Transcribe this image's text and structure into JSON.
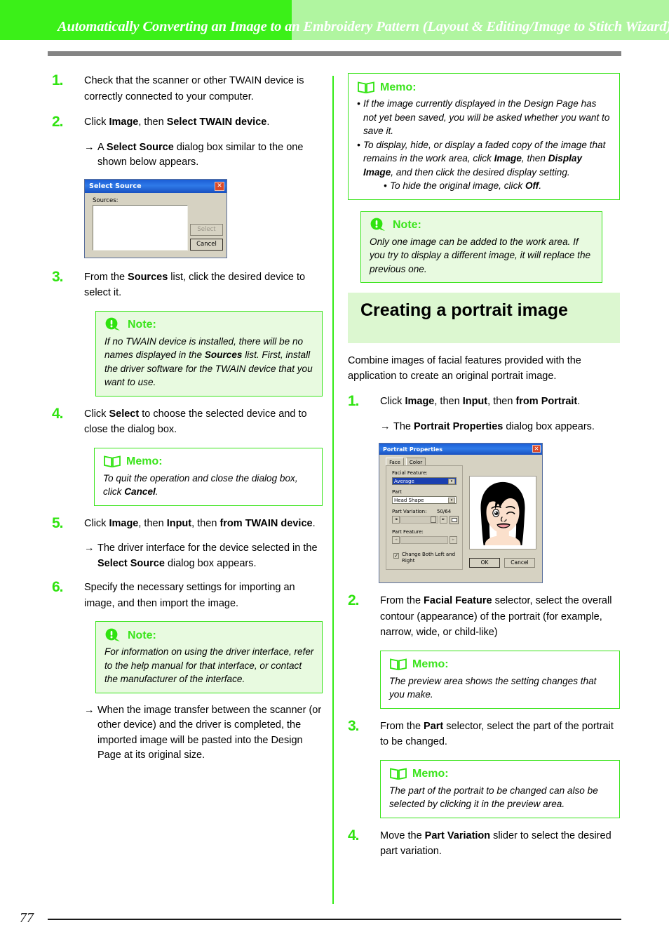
{
  "header": {
    "title": "Automatically Converting an Image to an Embroidery Pattern (Layout & Editing/Image to Stitch Wizard)",
    "band_color_dark": "#3bf018",
    "band_color_light": "#b0f5a0",
    "rule_color": "#848484"
  },
  "footer": {
    "page_number": "77"
  },
  "accent": {
    "green": "#2fe30f",
    "note_bg": "#e8fae0",
    "section_bg": "#dcf7d0",
    "divider": "#34ec16"
  },
  "left_column": {
    "steps": [
      {
        "number": "1.",
        "text_parts": [
          {
            "t": "Check that the scanner or other TWAIN device is correctly connected to your computer.",
            "b": false
          }
        ]
      },
      {
        "number": "2.",
        "text_parts": [
          {
            "t": "Click ",
            "b": false
          },
          {
            "t": "Image",
            "b": true
          },
          {
            "t": ", then ",
            "b": false
          },
          {
            "t": "Select TWAIN device",
            "b": true
          },
          {
            "t": ".",
            "b": false
          }
        ]
      },
      {
        "number": "3.",
        "text_parts": [
          {
            "t": "From the ",
            "b": false
          },
          {
            "t": "Sources",
            "b": true
          },
          {
            "t": " list, click the desired device to select it.",
            "b": false
          }
        ]
      },
      {
        "number": "4.",
        "text_parts": [
          {
            "t": "Click ",
            "b": false
          },
          {
            "t": "Select",
            "b": true
          },
          {
            "t": " to choose the selected device and to close the dialog box.",
            "b": false
          }
        ]
      },
      {
        "number": "5.",
        "text_parts": [
          {
            "t": "Click ",
            "b": false
          },
          {
            "t": "Image",
            "b": true
          },
          {
            "t": ", then ",
            "b": false
          },
          {
            "t": "Input",
            "b": true
          },
          {
            "t": ", then ",
            "b": false
          },
          {
            "t": "from TWAIN device",
            "b": true
          },
          {
            "t": ".",
            "b": false
          }
        ]
      },
      {
        "number": "6.",
        "text_parts": [
          {
            "t": "Specify the necessary settings for importing an image, and then import the image.",
            "b": false
          }
        ]
      }
    ],
    "arrow_glyph": "→",
    "arrow_2": [
      {
        "t": "A ",
        "b": false
      },
      {
        "t": "Select Source",
        "b": true
      },
      {
        "t": " dialog box similar to the one shown below appears.",
        "b": false
      }
    ],
    "arrow_5": [
      {
        "t": "The driver interface for the device selected in the ",
        "b": false
      },
      {
        "t": "Select Source",
        "b": true
      },
      {
        "t": " dialog box appears.",
        "b": false
      }
    ],
    "arrow_6": [
      {
        "t": "When the image transfer between the scanner (or other device) and the driver is completed, the imported image will be pasted into the Design Page at its original size.",
        "b": false
      }
    ],
    "note_3": {
      "label": "Note:",
      "icon": "note-bubble-icon",
      "parts": [
        {
          "t": "If no TWAIN device is installed, there will be no names displayed in the ",
          "b": false
        },
        {
          "t": "Sources",
          "b": true
        },
        {
          "t": " list. First, install the driver software for the TWAIN device that you want to use.",
          "b": false
        }
      ]
    },
    "memo_4": {
      "label": "Memo:",
      "icon": "memo-book-icon",
      "parts": [
        {
          "t": "To quit the operation and close the dialog box, click ",
          "b": false
        },
        {
          "t": "Cancel",
          "b": true
        },
        {
          "t": ".",
          "b": false
        }
      ]
    },
    "note_6": {
      "label": "Note:",
      "icon": "note-bubble-icon",
      "parts": [
        {
          "t": "For information on using the driver interface, refer to the help manual for that interface, or contact the manufacturer of the interface.",
          "b": false
        }
      ]
    },
    "select_source_dialog": {
      "title": "Select Source",
      "close_glyph": "✕",
      "sources_label": "Sources:",
      "select_button": "Select",
      "cancel_button": "Cancel",
      "list_items": []
    }
  },
  "right_column": {
    "memo_top": {
      "label": "Memo:",
      "icon": "memo-book-icon",
      "bullet_glyph": "•",
      "bullets": [
        {
          "parts": [
            {
              "t": "If the image currently displayed in the Design Page has not yet been saved, you will be asked whether you want to save it.",
              "b": false
            }
          ]
        },
        {
          "parts": [
            {
              "t": "To display, hide, or display a faded copy of the image that remains in the work area, click ",
              "b": false
            },
            {
              "t": "Image",
              "b": true
            },
            {
              "t": ", then ",
              "b": false
            },
            {
              "t": "Display Image",
              "b": true
            },
            {
              "t": ", and then click the desired display setting.",
              "b": false
            }
          ]
        }
      ],
      "sub_bullet": [
        {
          "t": "To hide the original image, click ",
          "b": false
        },
        {
          "t": "Off",
          "b": true
        },
        {
          "t": ".",
          "b": false
        }
      ]
    },
    "note_top": {
      "label": "Note:",
      "icon": "note-bubble-icon",
      "parts": [
        {
          "t": "Only one image can be added to the work area. If you try to display a different image, it will replace the previous one.",
          "b": false
        }
      ]
    },
    "section_heading": "Creating a portrait image",
    "intro": "Combine images of facial features provided with the application to create an original portrait image.",
    "steps": [
      {
        "number": "1.",
        "text_parts": [
          {
            "t": "Click ",
            "b": false
          },
          {
            "t": "Image",
            "b": true
          },
          {
            "t": ", then ",
            "b": false
          },
          {
            "t": "Input",
            "b": true
          },
          {
            "t": ", then ",
            "b": false
          },
          {
            "t": "from Portrait",
            "b": true
          },
          {
            "t": ".",
            "b": false
          }
        ]
      },
      {
        "number": "2.",
        "text_parts": [
          {
            "t": "From the ",
            "b": false
          },
          {
            "t": "Facial Feature",
            "b": true
          },
          {
            "t": " selector, select the overall contour (appearance) of the portrait (for example, narrow, wide, or child-like)",
            "b": false
          }
        ]
      },
      {
        "number": "3.",
        "text_parts": [
          {
            "t": "From the ",
            "b": false
          },
          {
            "t": "Part",
            "b": true
          },
          {
            "t": " selector, select the part of the portrait to be changed.",
            "b": false
          }
        ]
      },
      {
        "number": "4.",
        "text_parts": [
          {
            "t": "Move the ",
            "b": false
          },
          {
            "t": "Part Variation",
            "b": true
          },
          {
            "t": " slider to select the desired part variation.",
            "b": false
          }
        ]
      }
    ],
    "arrow_glyph": "→",
    "arrow_1": [
      {
        "t": "The ",
        "b": false
      },
      {
        "t": "Portrait Properties",
        "b": true
      },
      {
        "t": " dialog box appears.",
        "b": false
      }
    ],
    "memo_2": {
      "label": "Memo:",
      "icon": "memo-book-icon",
      "parts": [
        {
          "t": "The preview area shows the setting changes that you make.",
          "b": false
        }
      ]
    },
    "memo_3": {
      "label": "Memo:",
      "icon": "memo-book-icon",
      "parts": [
        {
          "t": "The part of the portrait to be changed can also be selected by clicking it in the preview area.",
          "b": false
        }
      ]
    },
    "portrait_dialog": {
      "title": "Portrait Properties",
      "close_glyph": "✕",
      "tab_face": "Face",
      "tab_color": "Color",
      "facial_feature_label": "Facial Feature:",
      "facial_feature_value": "Average",
      "part_label": "Part",
      "part_value": "Head Shape",
      "part_variation_label": "Part Variation:",
      "part_variation_value": "50/64",
      "part_feature_label": "Part Feature:",
      "checkbox_label": "Change Both Left and Right",
      "checkbox_glyph": "✓",
      "ok_button": "OK",
      "cancel_button": "Cancel",
      "left_arrow": "◄",
      "right_arrow": "►",
      "dropdown_arrow": "▾"
    }
  }
}
